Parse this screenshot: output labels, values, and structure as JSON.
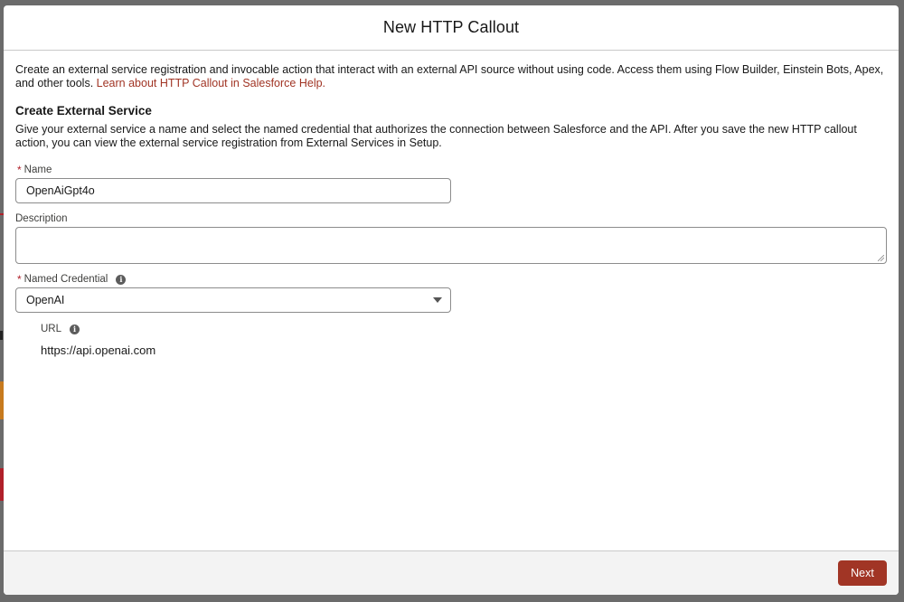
{
  "modal": {
    "title": "New HTTP Callout"
  },
  "intro": {
    "text": "Create an external service registration and invocable action that interact with an external API source without using code. Access them using Flow Builder, Einstein Bots, Apex, and other tools.",
    "link": "Learn about HTTP Callout in Salesforce Help."
  },
  "section": {
    "title": "Create External Service",
    "description": "Give your external service a name and select the named credential that authorizes the connection between Salesforce and the API. After you save the new HTTP callout action, you can view the external service registration from External Services in Setup."
  },
  "fields": {
    "name": {
      "required_mark": "*",
      "label": "Name",
      "value": "OpenAiGpt4o"
    },
    "description": {
      "label": "Description",
      "value": ""
    },
    "named_credential": {
      "required_mark": "*",
      "label": "Named Credential",
      "selected": "OpenAI",
      "info_icon": "info-icon"
    },
    "url": {
      "label": "URL",
      "value": "https://api.openai.com",
      "info_icon": "info-icon"
    }
  },
  "footer": {
    "next_label": "Next"
  },
  "colors": {
    "brand_button": "#a13525",
    "link": "#a13525",
    "required": "#b0202a",
    "overlay": "#6b6b6b"
  }
}
